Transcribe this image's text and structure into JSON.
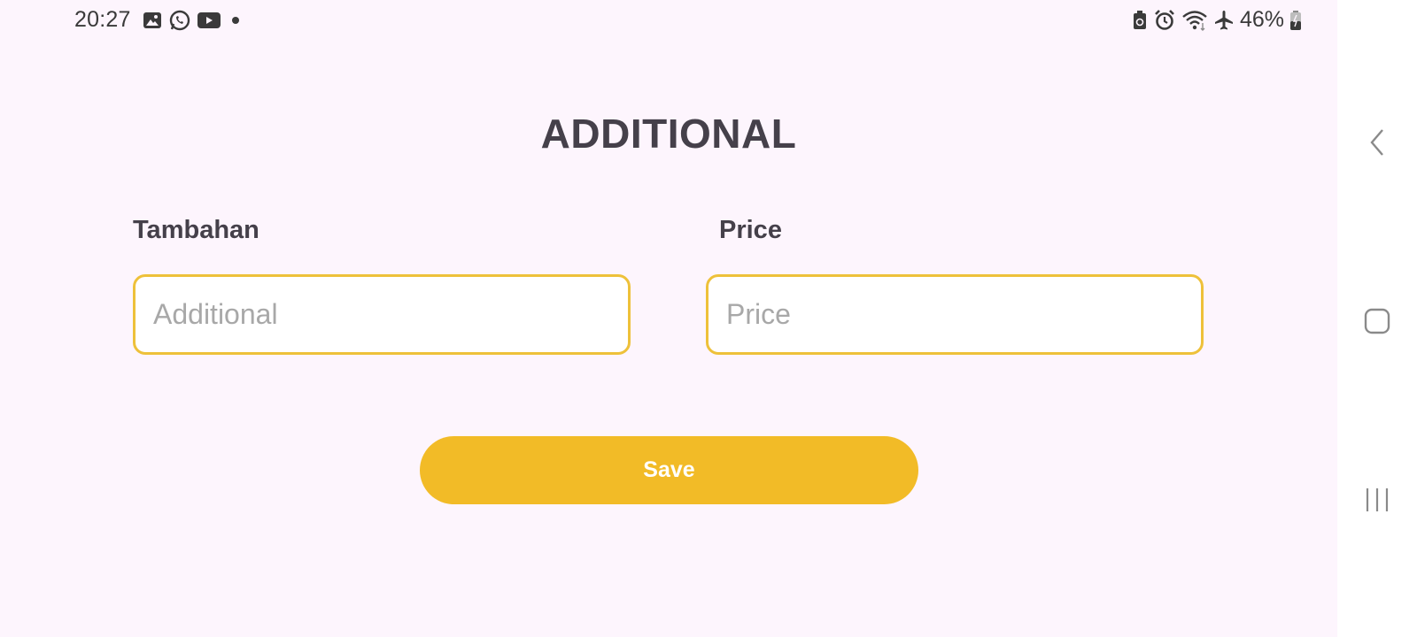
{
  "status_bar": {
    "time": "20:27",
    "left_icons": [
      "gallery-icon",
      "whatsapp-icon",
      "youtube-icon",
      "notification-dot-icon"
    ],
    "right_icons": [
      "battery-saver-icon",
      "alarm-icon",
      "wifi-icon",
      "airplane-mode-icon"
    ],
    "battery_percent": "46%"
  },
  "page": {
    "title": "ADDITIONAL"
  },
  "form": {
    "additional_label": "Tambahan",
    "additional_placeholder": "Additional",
    "additional_value": "",
    "price_label": "Price",
    "price_placeholder": "Price",
    "price_value": "",
    "save_label": "Save"
  },
  "nav_bar": {
    "icons": [
      "back-icon",
      "home-icon",
      "recent-apps-icon"
    ]
  },
  "colors": {
    "background": "#fdf5fd",
    "accent": "#f2bb27",
    "input_border": "#eec13a",
    "text": "#45404a"
  }
}
